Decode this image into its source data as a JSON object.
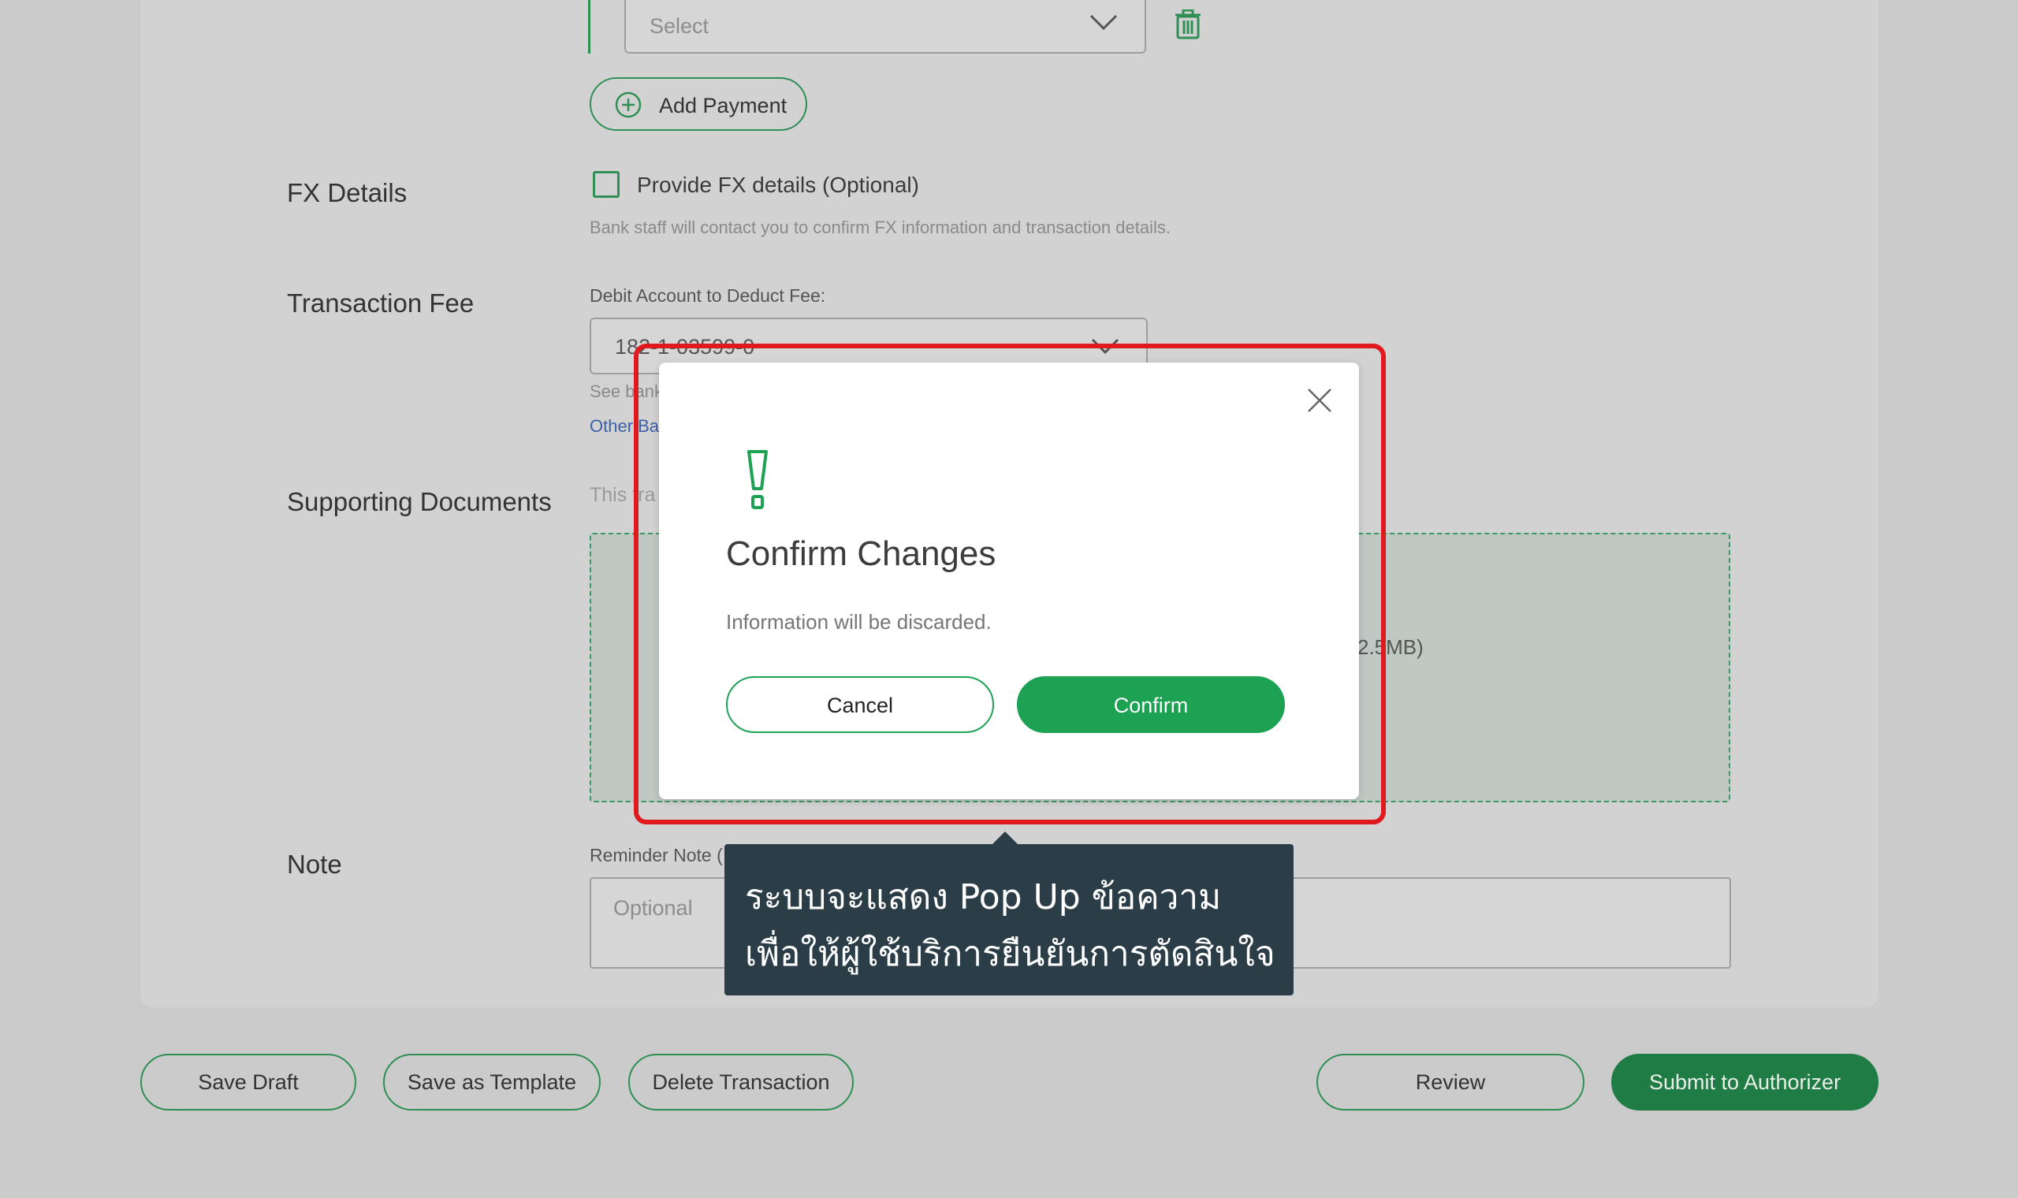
{
  "payment": {
    "select_placeholder": "Select",
    "add_payment_label": "Add Payment"
  },
  "fx": {
    "section_label": "FX Details",
    "checkbox_label": "Provide FX details (Optional)",
    "hint": "Bank staff will contact you to confirm FX information and transaction details."
  },
  "fee": {
    "section_label": "Transaction Fee",
    "field_label": "Debit Account to Deduct Fee:",
    "account_value": "182-1-03599-0",
    "partial_see": "See bank",
    "partial_other": "Other Ba"
  },
  "documents": {
    "section_label": "Supporting Documents",
    "partial_this": "This tra",
    "partial_size": "2.5MB)"
  },
  "note": {
    "section_label": "Note",
    "field_label": "Reminder Note (",
    "placeholder": "Optional"
  },
  "footer": {
    "save_draft": "Save Draft",
    "save_template": "Save as Template",
    "delete_transaction": "Delete Transaction",
    "review": "Review",
    "submit": "Submit to Authorizer"
  },
  "modal": {
    "title": "Confirm Changes",
    "message": "Information will be discarded.",
    "cancel": "Cancel",
    "confirm": "Confirm"
  },
  "annotation": {
    "line1": "ระบบจะแสดง Pop Up ข้อความ",
    "line2": "เพื่อให้ผู้ใช้บริการยืนยันการตัดสินใจ"
  },
  "colors": {
    "brand_green": "#1da254",
    "highlight_red": "#e0191f",
    "tooltip_bg": "#2b3e48"
  },
  "icons": {
    "dropdown": "chevron-down-icon",
    "delete": "trash-icon",
    "add": "plus-circle-icon",
    "close": "close-icon",
    "warning": "exclamation-icon"
  }
}
